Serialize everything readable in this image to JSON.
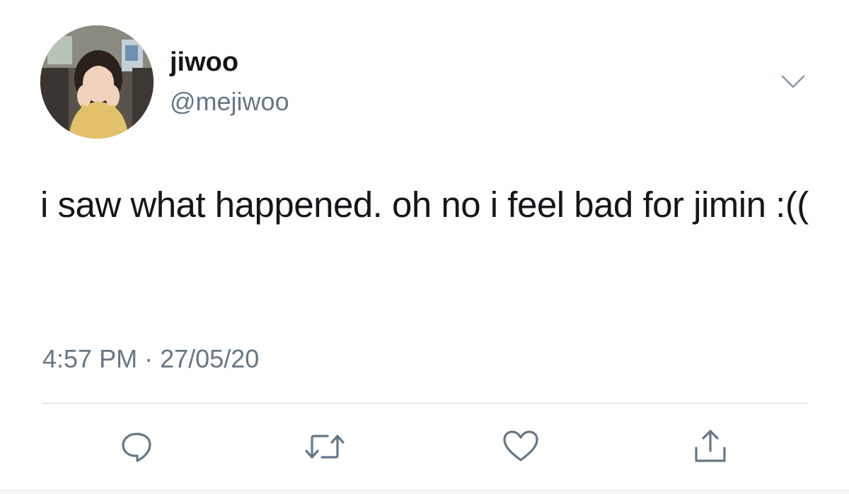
{
  "tweet": {
    "author": {
      "display_name": "jiwoo",
      "handle": "@mejiwoo"
    },
    "text": "i saw what happened. oh no i feel bad for jimin :((",
    "time": "4:57 PM",
    "separator": "·",
    "date": "27/05/20"
  },
  "actions": {
    "reply_icon": "reply-icon",
    "retweet_icon": "retweet-icon",
    "like_icon": "heart-icon",
    "share_icon": "share-icon"
  },
  "colors": {
    "text_primary": "#14171a",
    "text_secondary": "#657786",
    "divider": "#cfd6dc",
    "icon": "#657786"
  }
}
